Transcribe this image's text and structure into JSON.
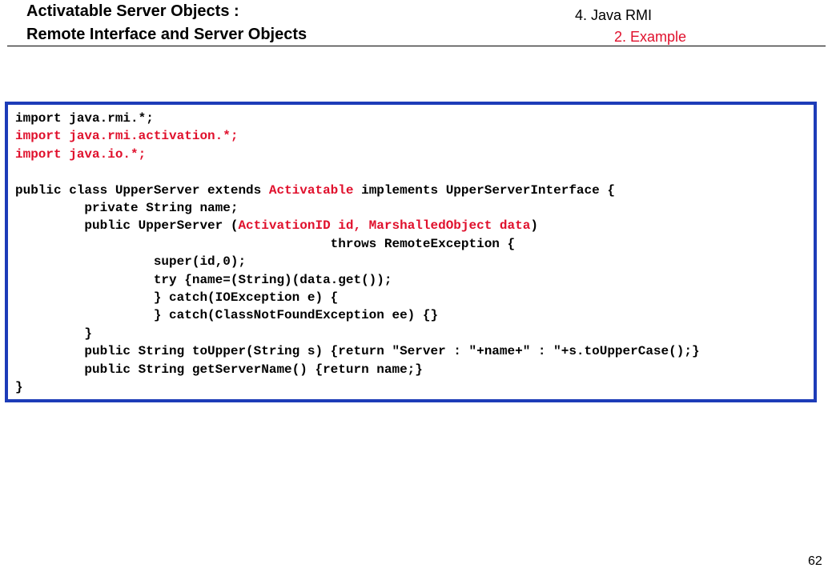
{
  "title": {
    "line1": "Activatable Server Objects :",
    "line2": "Remote Interface and Server Objects"
  },
  "section": {
    "chapter": "4. Java RMI",
    "subsection": "2. Example"
  },
  "colors": {
    "accent_red": "#e0102c",
    "frame_blue": "#1d3cb8"
  },
  "code_lines": [
    [
      {
        "t": "import java.rmi.*;"
      }
    ],
    [
      {
        "t": "import java.rmi.activation.*;",
        "c": "red"
      }
    ],
    [
      {
        "t": "import java.io.*;",
        "c": "red"
      }
    ],
    [],
    [
      {
        "t": "public class UpperServer extends "
      },
      {
        "t": "Activatable",
        "c": "red"
      },
      {
        "t": " implements UpperServerInterface {"
      }
    ],
    [
      {
        "t": "         private String name;"
      }
    ],
    [
      {
        "t": "         public UpperServer ("
      },
      {
        "t": "ActivationID id, MarshalledObject data",
        "c": "red"
      },
      {
        "t": ")"
      }
    ],
    [
      {
        "t": "                                         throws RemoteException {"
      }
    ],
    [
      {
        "t": "                  super(id,0);"
      }
    ],
    [
      {
        "t": "                  try {name=(String)(data.get());"
      }
    ],
    [
      {
        "t": "                  } catch(IOException e) {"
      }
    ],
    [
      {
        "t": "                  } catch(ClassNotFoundException ee) {}"
      }
    ],
    [
      {
        "t": "         }"
      }
    ],
    [
      {
        "t": "         public String toUpper(String s) {return \"Server : \"+name+\" : \"+s.toUpperCase();}"
      }
    ],
    [
      {
        "t": "         public String getServerName() {return name;}"
      }
    ],
    [
      {
        "t": "}"
      }
    ]
  ],
  "page_number": "62"
}
